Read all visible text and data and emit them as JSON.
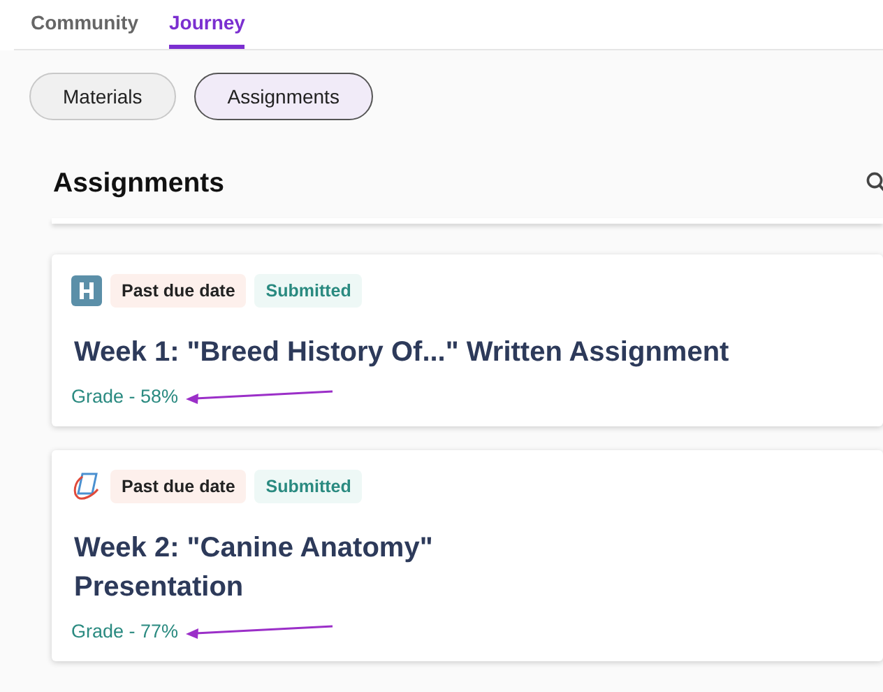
{
  "tabs": [
    {
      "label": "Community",
      "selected": false
    },
    {
      "label": "Journey",
      "selected": true
    }
  ],
  "filters": [
    {
      "label": "Materials",
      "selected": false
    },
    {
      "label": "Assignments",
      "selected": true
    }
  ],
  "section": {
    "title": "Assignments"
  },
  "assignments": [
    {
      "kind": "h-logo",
      "badges": [
        {
          "kind": "past_due",
          "label": "Past due date"
        },
        {
          "kind": "submitted",
          "label": "Submitted"
        }
      ],
      "title": "Week 1: \"Breed History Of...\" Written Assignment",
      "grade": "Grade - 58%",
      "arrow": true
    },
    {
      "kind": "document",
      "badges": [
        {
          "kind": "past_due",
          "label": "Past due date"
        },
        {
          "kind": "submitted",
          "label": "Submitted"
        }
      ],
      "title": "Week 2: \"Canine Anatomy\"\nPresentation",
      "grade": "Grade - 77%",
      "arrow": true
    }
  ]
}
